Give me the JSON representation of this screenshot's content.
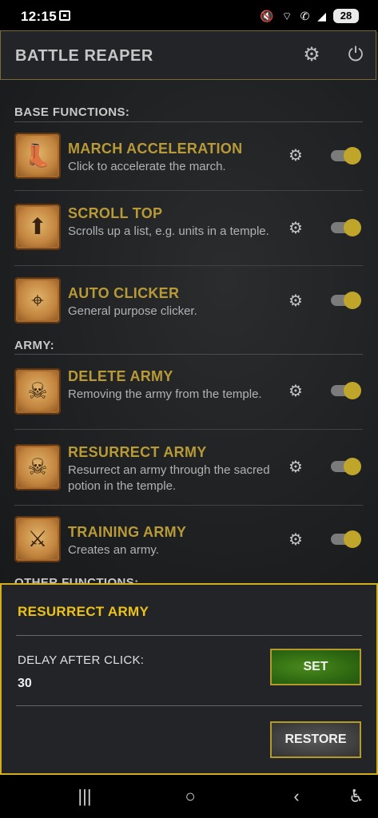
{
  "status_bar": {
    "time": "12:15",
    "icons": "🔇 ⌔ ✆ ◢",
    "battery": "28"
  },
  "header": {
    "title": "BATTLE REAPER",
    "settings_icon": "gear-icon",
    "power_icon": "power-icon"
  },
  "sections": [
    {
      "label": "BASE FUNCTIONS:"
    },
    {
      "label": "ARMY:"
    },
    {
      "label": "OTHER FUNCTIONS:"
    }
  ],
  "items": [
    {
      "title": "MARCH ACCELERATION",
      "desc": "Click to accelerate the march.",
      "icon": "boot-icon",
      "enabled": true
    },
    {
      "title": "SCROLL TOP",
      "desc": "Scrolls up a list, e.g. units in a temple.",
      "icon": "arrow-up-icon",
      "enabled": true
    },
    {
      "title": "AUTO CLICKER",
      "desc": "General purpose clicker.",
      "icon": "crosshair-icon",
      "enabled": true
    },
    {
      "title": "DELETE ARMY",
      "desc": "Removing the army from the temple.",
      "icon": "skeleton-delete-icon",
      "enabled": true
    },
    {
      "title": "RESURRECT ARMY",
      "desc": "Resurrect an army through the sacred potion in the temple.",
      "icon": "skeleton-plus-icon",
      "enabled": true
    },
    {
      "title": "TRAINING ARMY",
      "desc": "Creates an army.",
      "icon": "soldier-plus-icon",
      "enabled": true
    }
  ],
  "panel": {
    "title": "RESURRECT ARMY",
    "delay_label": "DELAY AFTER CLICK:",
    "delay_value": "30",
    "set_label": "SET",
    "restore_label": "RESTORE"
  },
  "colors": {
    "accent": "#ecc21a",
    "title_gold": "#b89a37",
    "toggle_on": "#c0a52b",
    "set_green": "#2f6a12"
  }
}
